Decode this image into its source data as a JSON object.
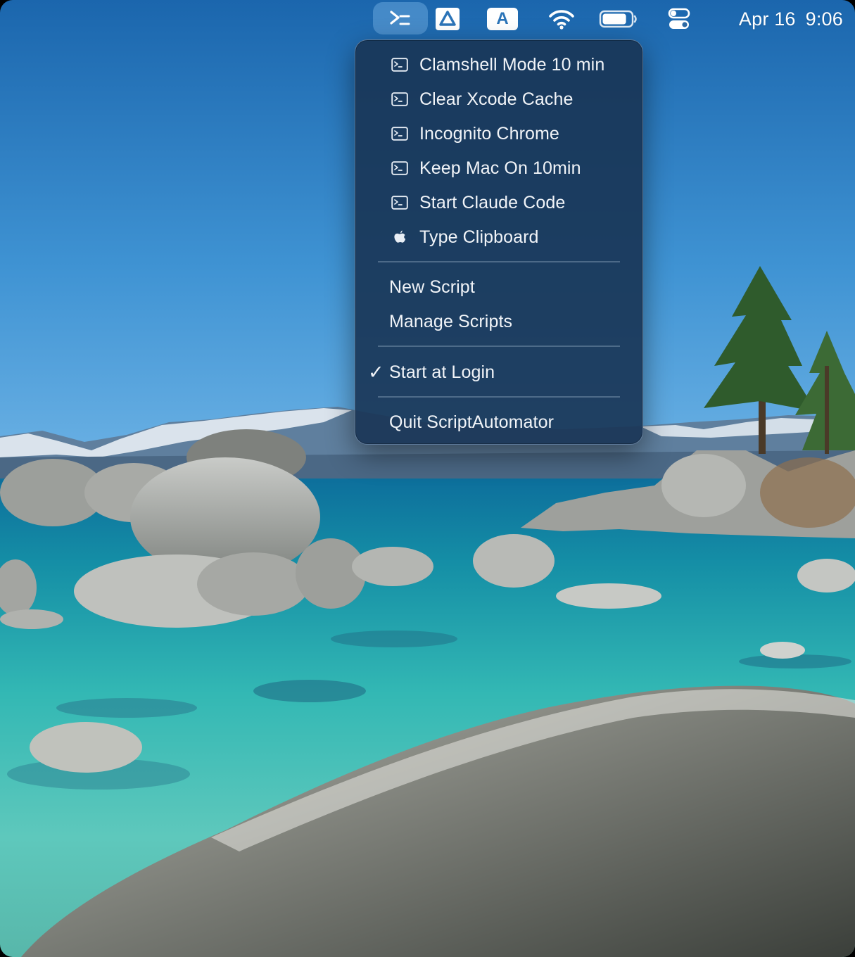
{
  "menubar": {
    "date": "Apr 16",
    "time": "9:06",
    "items": [
      {
        "name": "script-automator-status-item",
        "icon": "terminal-prompt-icon"
      },
      {
        "name": "drive-status-item",
        "icon": "drive-triangle-icon"
      },
      {
        "name": "keyboard-input-status-item",
        "icon": "keyboard-a-icon",
        "label": "A"
      },
      {
        "name": "wifi-status-item",
        "icon": "wifi-icon"
      },
      {
        "name": "battery-status-item",
        "icon": "battery-icon",
        "level": 0.85
      },
      {
        "name": "control-center-status-item",
        "icon": "control-center-icon"
      }
    ]
  },
  "menu": {
    "scripts": [
      {
        "label": "Clamshell Mode 10 min",
        "icon": "terminal-script-icon"
      },
      {
        "label": "Clear Xcode Cache",
        "icon": "terminal-script-icon"
      },
      {
        "label": "Incognito Chrome",
        "icon": "terminal-script-icon"
      },
      {
        "label": "Keep Mac On 10min",
        "icon": "terminal-script-icon"
      },
      {
        "label": "Start Claude Code",
        "icon": "terminal-script-icon"
      },
      {
        "label": "Type Clipboard",
        "icon": "apple-script-icon"
      }
    ],
    "new_script": "New Script",
    "manage_scripts": "Manage Scripts",
    "start_at_login": "Start at Login",
    "start_at_login_checked": true,
    "check_mark": "✓",
    "quit": "Quit ScriptAutomator"
  },
  "colors": {
    "menu_background": "#18344f",
    "sky_top": "#1e6fb8",
    "water": "#2fb5b0"
  }
}
